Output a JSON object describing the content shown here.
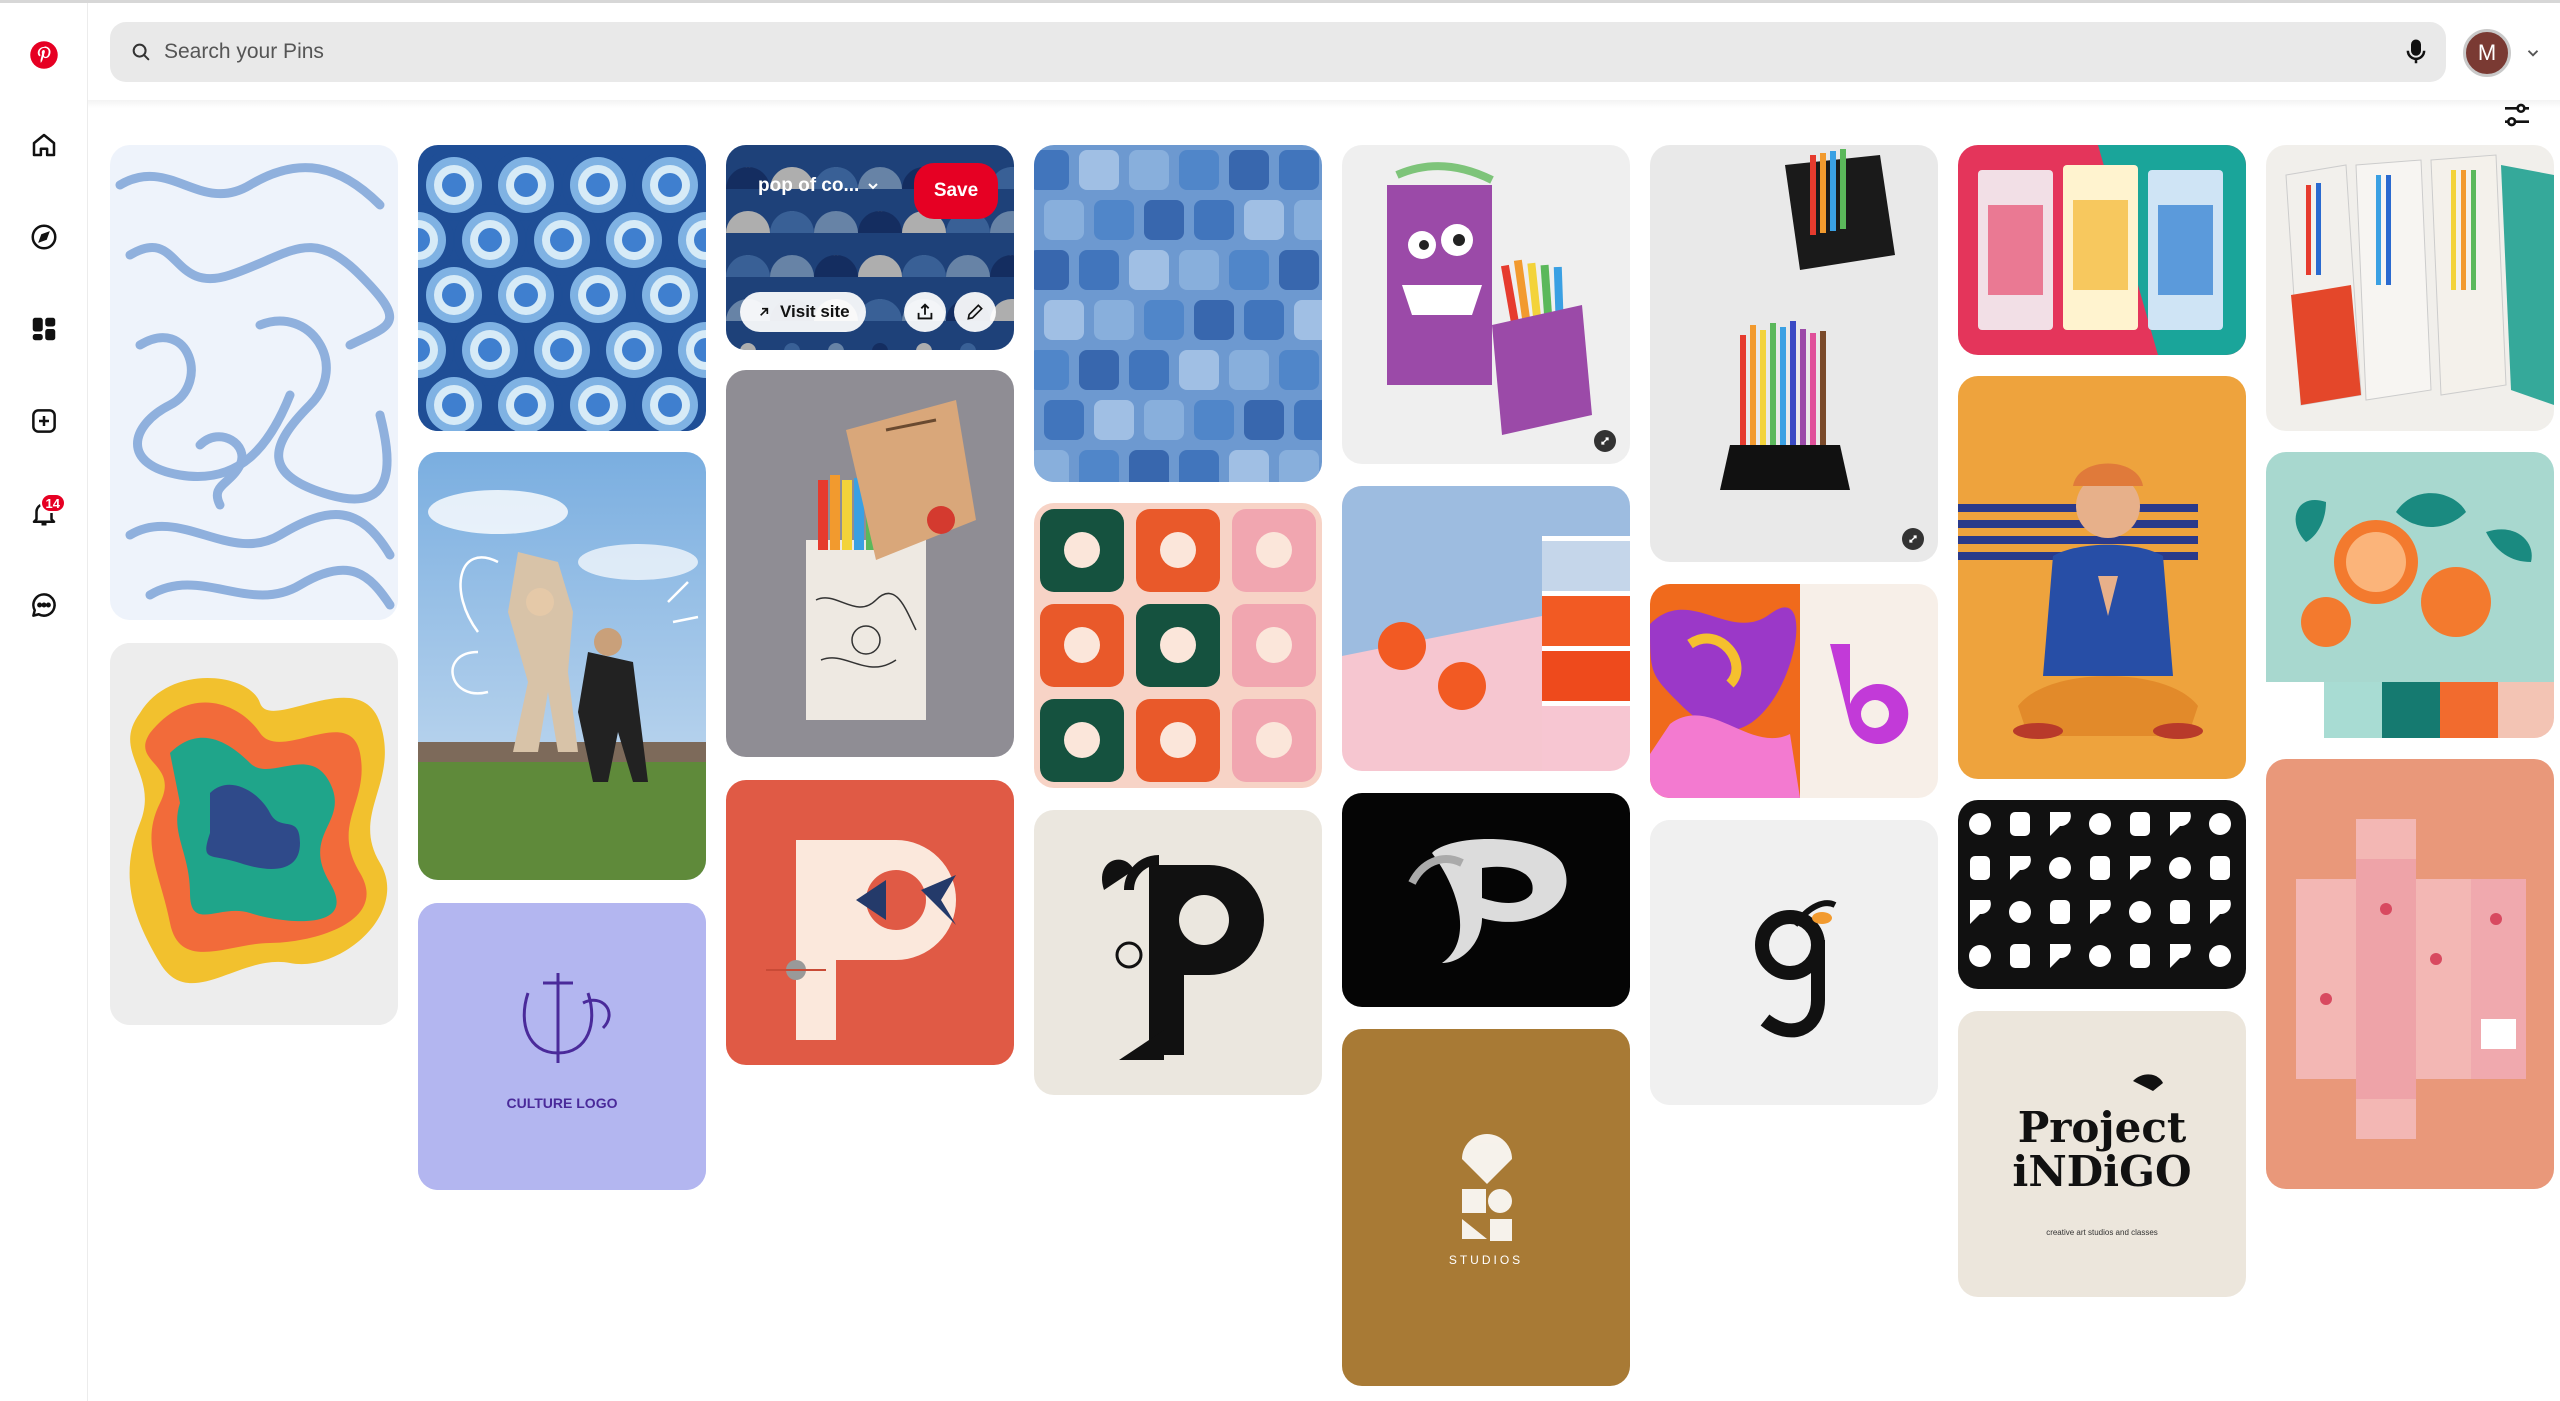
{
  "app": {
    "name": "Pinterest",
    "logo_icon": "pinterest-logo",
    "brand_color": "#e60023"
  },
  "sidebar": {
    "items": [
      {
        "name": "home",
        "icon": "home-icon"
      },
      {
        "name": "explore",
        "icon": "compass-icon"
      },
      {
        "name": "boards",
        "icon": "boards-icon"
      },
      {
        "name": "create",
        "icon": "plus-square-icon"
      },
      {
        "name": "notifications",
        "icon": "bell-icon",
        "badge": "14"
      },
      {
        "name": "messages",
        "icon": "chat-icon"
      }
    ]
  },
  "search": {
    "placeholder": "Search your Pins",
    "icon": "search-icon",
    "mic_icon": "microphone-icon"
  },
  "user": {
    "avatar_initial": "M"
  },
  "toolbar": {
    "filter_icon": "filter-sliders-icon"
  },
  "hovered_pin": {
    "board_label": "pop of co...",
    "save_label": "Save",
    "visit_label": "Visit site",
    "share_icon": "share-icon",
    "edit_icon": "pencil-icon"
  },
  "pins": [
    {
      "name": "blue-swirl-pattern"
    },
    {
      "name": "abstract-blob-pattern"
    },
    {
      "name": "blue-scallop-pattern"
    },
    {
      "name": "jumping-friends-photo"
    },
    {
      "name": "culture-logo",
      "text": "CULTURE LOGO"
    },
    {
      "name": "pop-of-color-pattern"
    },
    {
      "name": "marker-box-packaging"
    },
    {
      "name": "letter-p-geometric"
    },
    {
      "name": "blue-squares-pattern"
    },
    {
      "name": "groovy-letters-pattern"
    },
    {
      "name": "letter-p-serif"
    },
    {
      "name": "zombs-crayon-box"
    },
    {
      "name": "oranges-color-palette"
    },
    {
      "name": "letter-p-3d"
    },
    {
      "name": "studios-logo",
      "text": "STUDIOS"
    },
    {
      "name": "colored-pencils-box"
    },
    {
      "name": "letter-b-liquid"
    },
    {
      "name": "letter-g-logo"
    },
    {
      "name": "live-color-diy-packs"
    },
    {
      "name": "boy-sitting-photo"
    },
    {
      "name": "black-glyph-grid"
    },
    {
      "name": "project-indigo-logo",
      "text": "Project iNDiGO",
      "subtext": "creative art studios and classes"
    },
    {
      "name": "pencil-packaging"
    },
    {
      "name": "oranges-teal-palette"
    },
    {
      "name": "pink-box-dieline"
    }
  ]
}
